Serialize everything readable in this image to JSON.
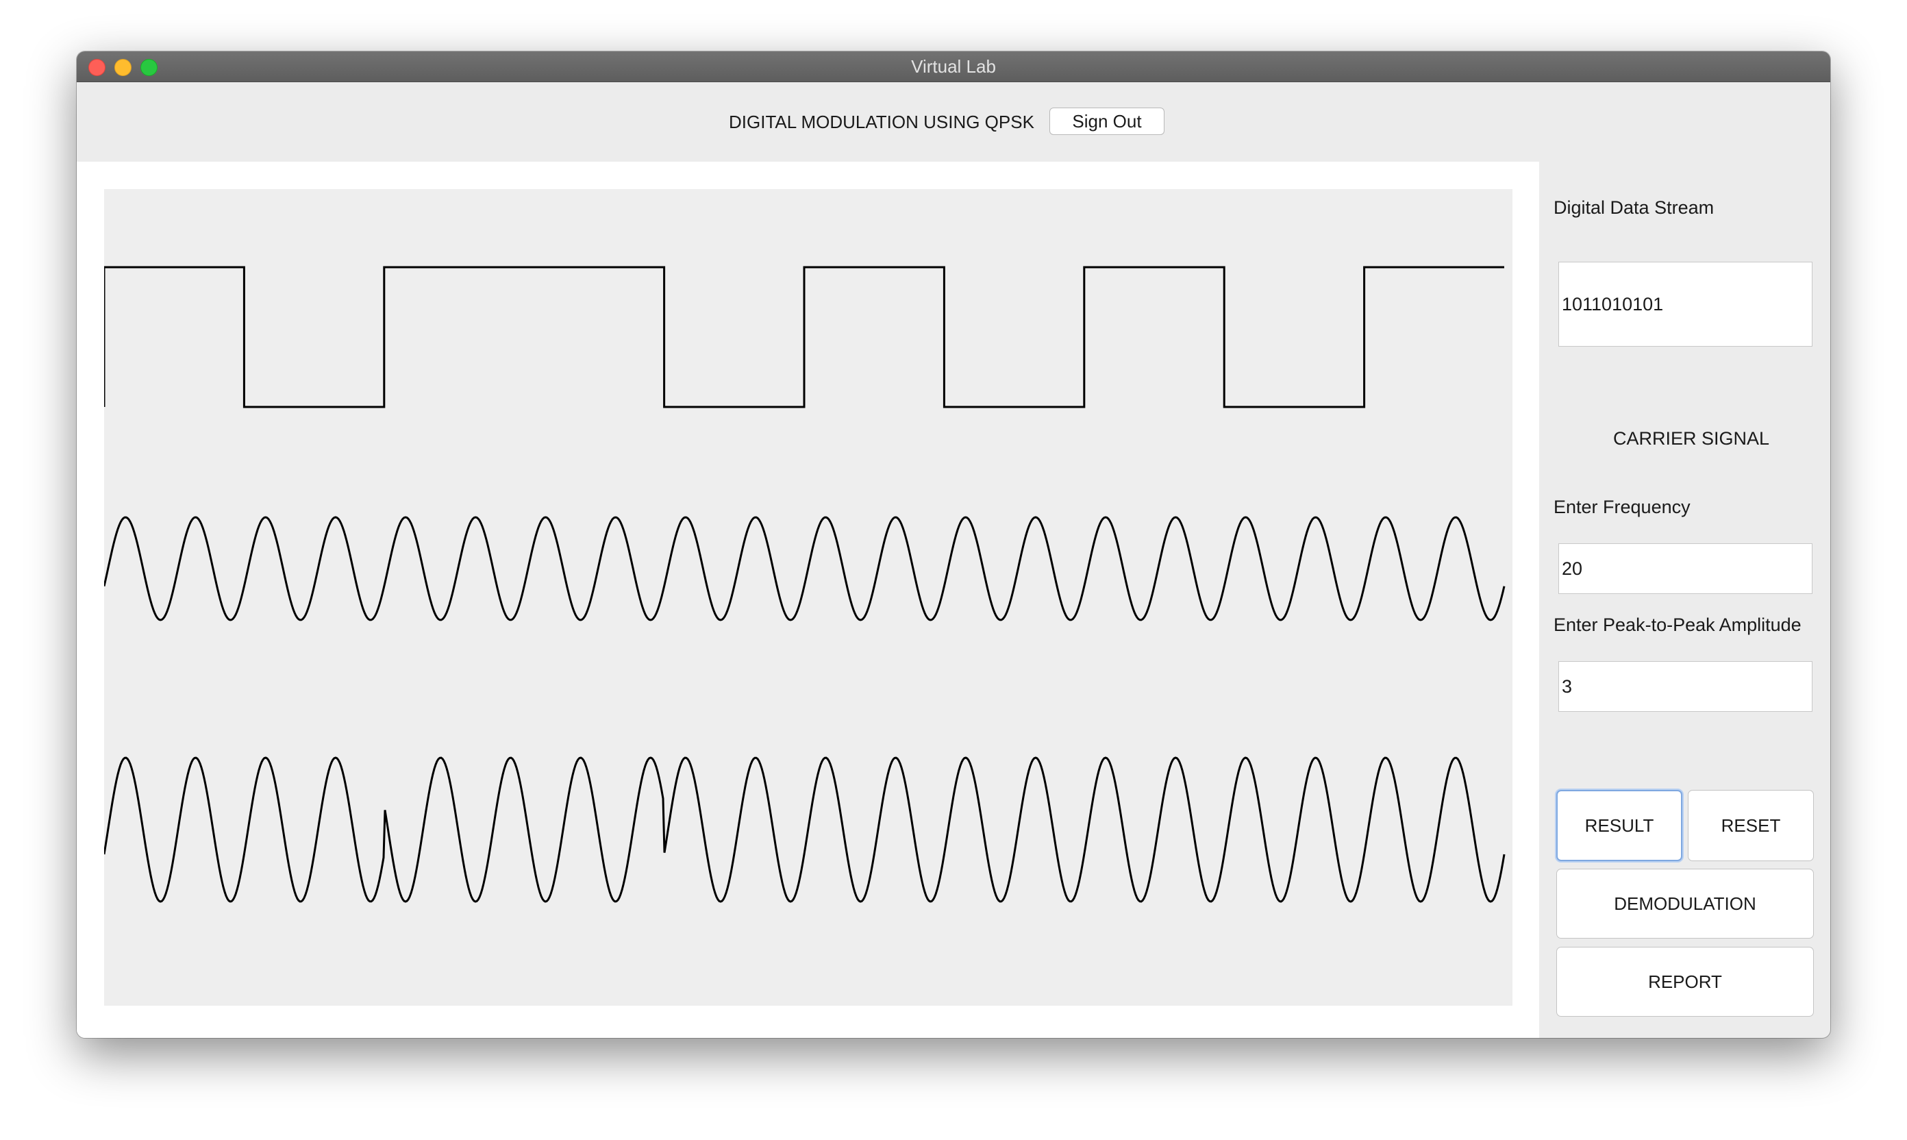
{
  "window": {
    "title": "Virtual Lab"
  },
  "header": {
    "title": "DIGITAL MODULATION USING QPSK",
    "sign_out_label": "Sign Out"
  },
  "side_panel": {
    "data_stream_label": "Digital Data Stream",
    "data_stream_value": "1011010101",
    "carrier_heading": "CARRIER SIGNAL",
    "frequency_label": "Enter Frequency",
    "frequency_value": "20",
    "amplitude_label": "Enter Peak-to-Peak Amplitude",
    "amplitude_value": "3",
    "buttons": {
      "result": "RESULT",
      "reset": "RESET",
      "demodulation": "DEMODULATION",
      "report": "REPORT"
    }
  },
  "plot": {
    "bits": [
      1,
      0,
      1,
      1,
      0,
      1,
      0,
      1,
      0,
      1
    ],
    "carrier_cycles": 20,
    "phase_flips_at_bit_boundaries": [
      2,
      4
    ]
  },
  "colors": {
    "window_bg": "#ececec",
    "plot_bg": "#eeeeee",
    "waveform": "#000000",
    "focus_ring": "#7fa8e0"
  }
}
